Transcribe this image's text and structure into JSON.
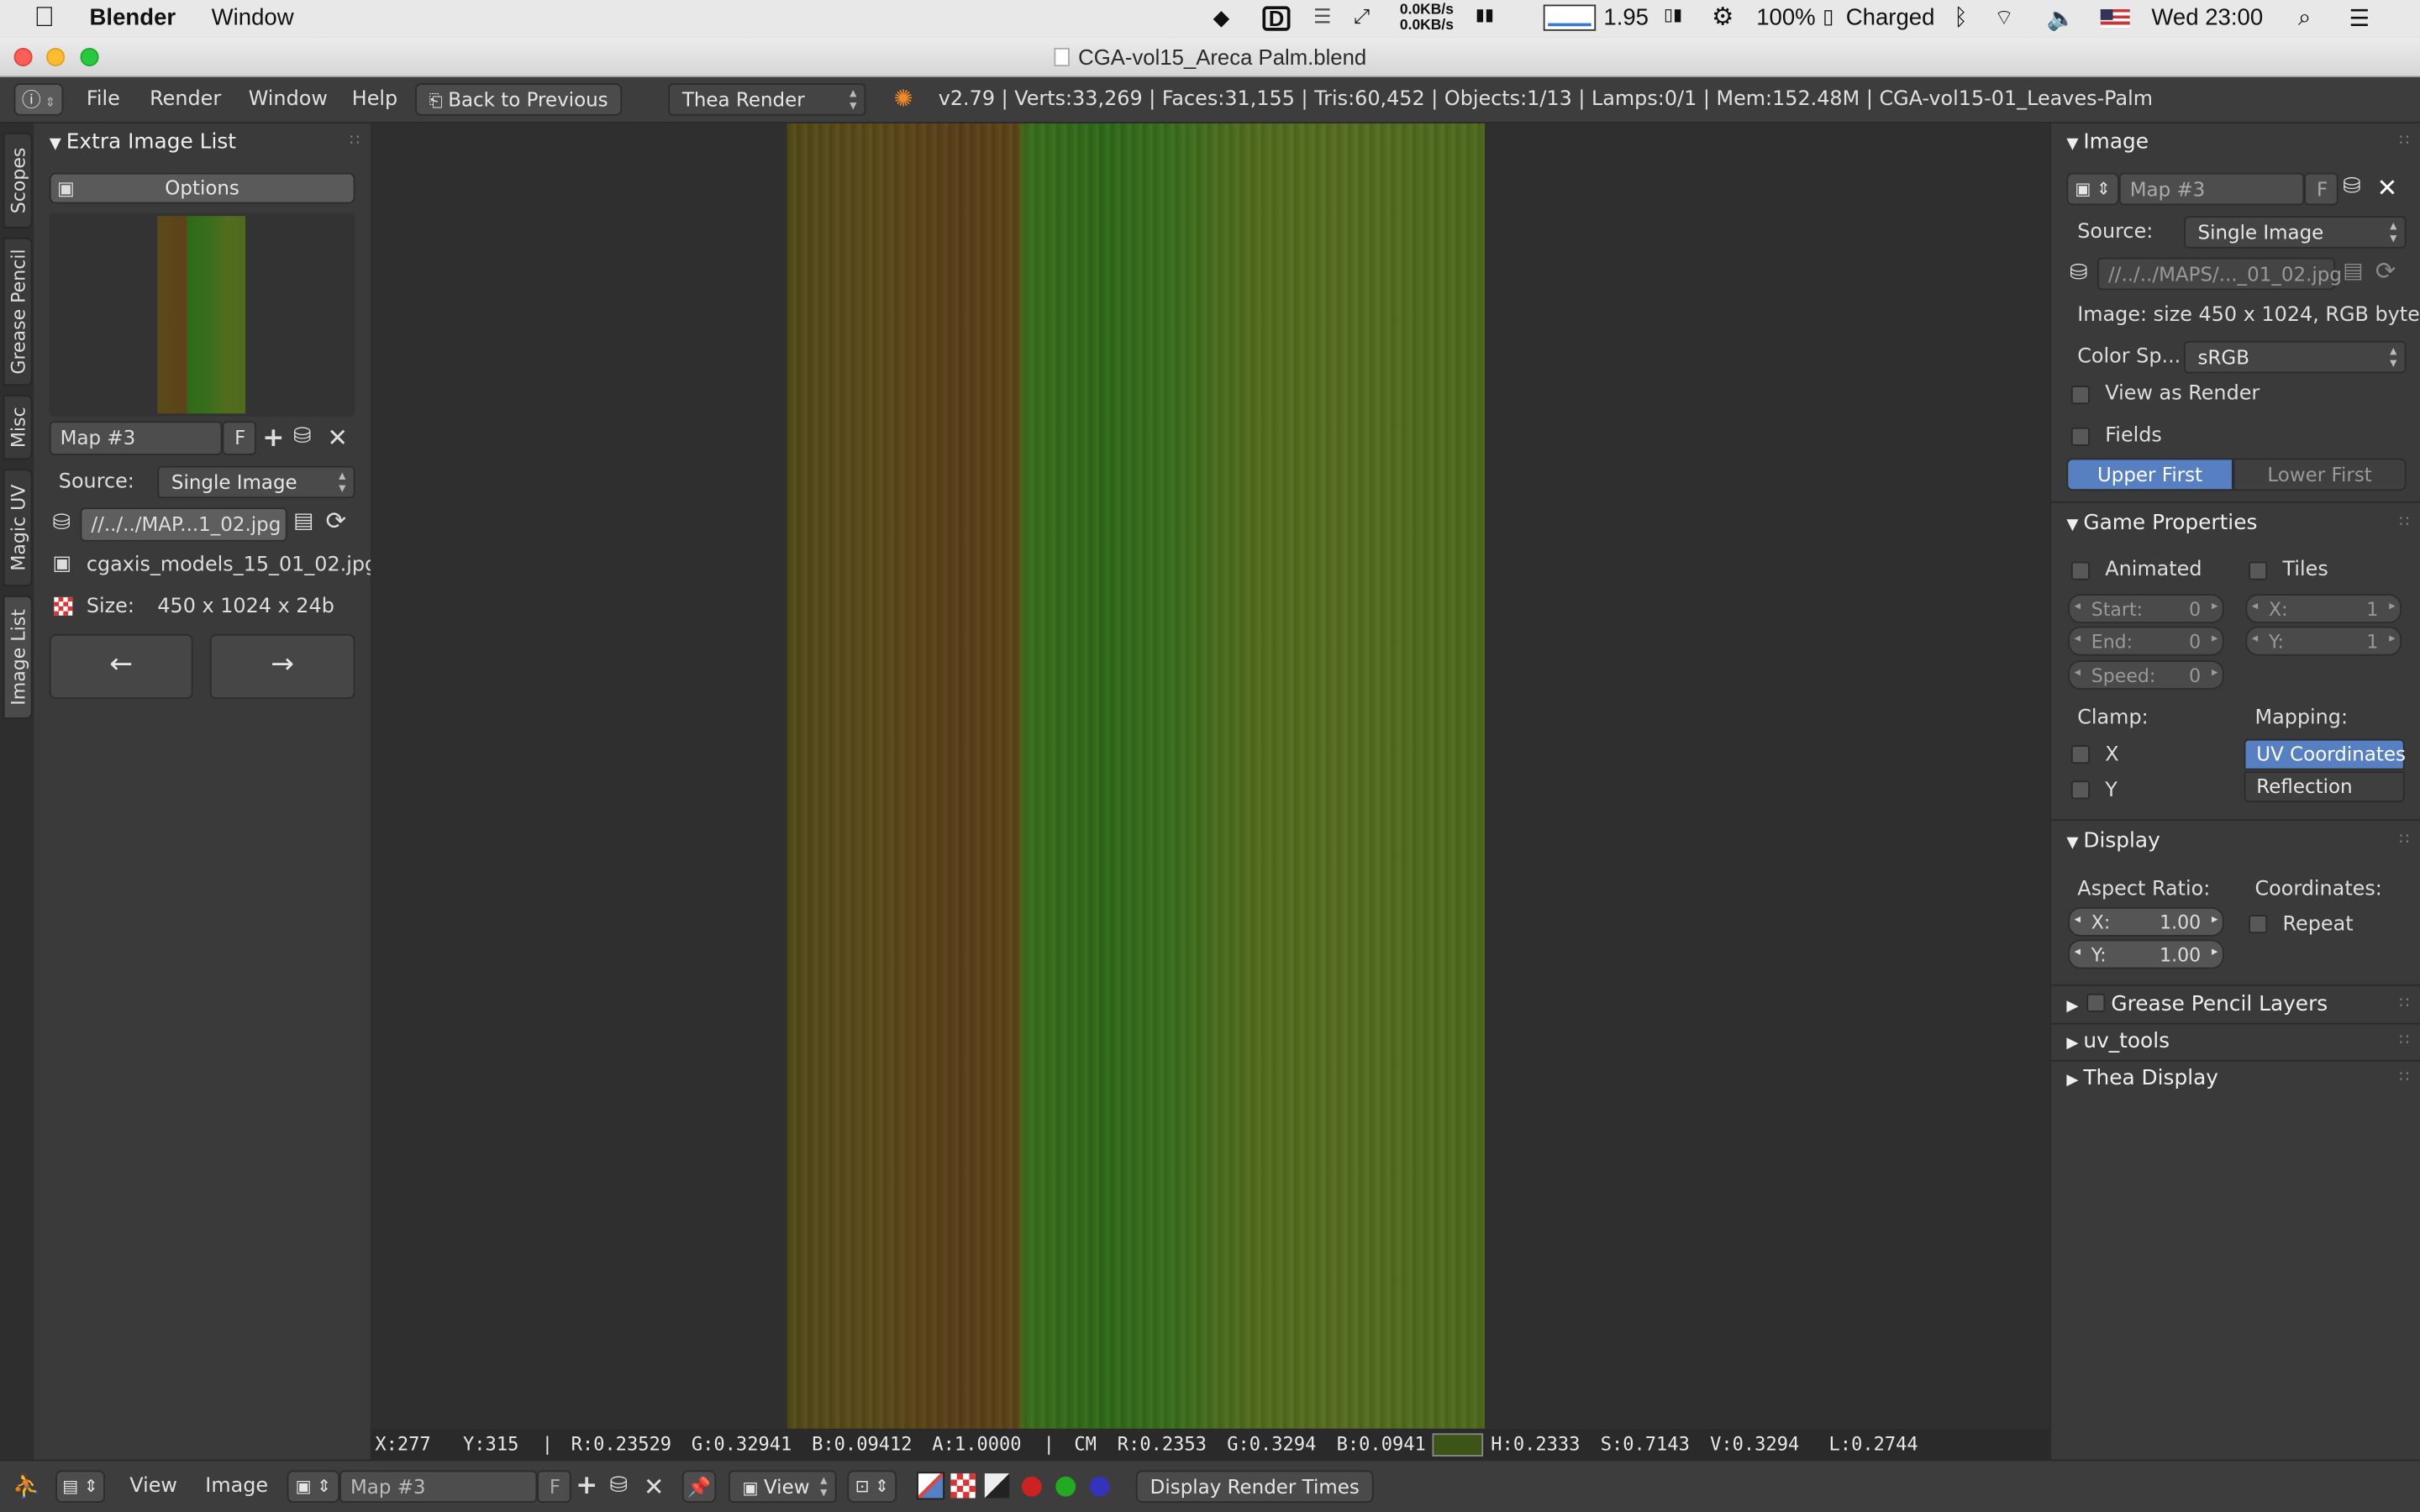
{
  "macbar": {
    "app": "Blender",
    "menu_window": "Window",
    "net_up": "0.0KB/s",
    "net_down": "0.0KB/s",
    "load": "1.95",
    "battery_pct": "100%",
    "battery_status": "Charged",
    "clock": "Wed 23:00"
  },
  "window": {
    "title": "CGA-vol15_Areca Palm.blend"
  },
  "header": {
    "menu": [
      "File",
      "Render",
      "Window",
      "Help"
    ],
    "back_button": "Back to Previous",
    "engine": "Thea Render",
    "stats": "v2.79 | Verts:33,269 | Faces:31,155 | Tris:60,452 | Objects:1/13 | Lamps:0/1 | Mem:152.48M | CGA-vol15-01_Leaves-Palm"
  },
  "side_tabs": [
    "Scopes",
    "Grease Pencil",
    "Misc",
    "Magic UV",
    "Image List"
  ],
  "left_panel": {
    "title": "Extra Image List",
    "options_button": "Options",
    "image_name": "Map #3",
    "fake_user": "F",
    "source_label": "Source:",
    "source_value": "Single Image",
    "filepath": "//../../MAP...1_02.jpg",
    "filename": "cgaxis_models_15_01_02.jpg",
    "size_label": "Size:",
    "size_value": "450 x 1024 x 24b",
    "prev_arrow": "←",
    "next_arrow": "→"
  },
  "sample_line": {
    "x": "X:277",
    "y": "Y:315",
    "r": "R:0.23529",
    "g": "G:0.32941",
    "b": "B:0.09412",
    "a": "A:1.0000",
    "cm": "CM",
    "cm_r": "R:0.2353",
    "cm_g": "G:0.3294",
    "cm_b": "B:0.0941",
    "swatch": "#3c5418",
    "h": "H:0.2333",
    "s": "S:0.7143",
    "v": "V:0.3294",
    "l": "L:0.2744"
  },
  "right_panel": {
    "image": {
      "title": "Image",
      "name": "Map #3",
      "fake_user": "F",
      "source_label": "Source:",
      "source_value": "Single Image",
      "filepath": "//../../MAPS/..._01_02.jpg",
      "info": "Image: size 450 x 1024, RGB byte",
      "colorspace_label": "Color Sp...",
      "colorspace_value": "sRGB",
      "view_as_render": "View as Render",
      "fields": "Fields",
      "upper_first": "Upper First",
      "lower_first": "Lower First"
    },
    "game": {
      "title": "Game Properties",
      "animated": "Animated",
      "tiles": "Tiles",
      "start_label": "Start:",
      "start_value": "0",
      "end_label": "End:",
      "end_value": "0",
      "speed_label": "Speed:",
      "speed_value": "0",
      "x_label": "X:",
      "x_value": "1",
      "y_label": "Y:",
      "y_value": "1",
      "clamp": "Clamp:",
      "mapping": "Mapping:",
      "clamp_x": "X",
      "clamp_y": "Y",
      "uv_coords": "UV Coordinates",
      "reflection": "Reflection"
    },
    "display": {
      "title": "Display",
      "aspect": "Aspect Ratio:",
      "coordinates": "Coordinates:",
      "ax_label": "X:",
      "ax_value": "1.00",
      "ay_label": "Y:",
      "ay_value": "1.00",
      "repeat": "Repeat"
    },
    "collapsed": [
      "Grease Pencil Layers",
      "uv_tools",
      "Thea Display"
    ]
  },
  "footer": {
    "view": "View",
    "image": "Image",
    "image_name": "Map #3",
    "fake_user": "F",
    "view_dd": "View",
    "render_times": "Display Render Times"
  }
}
